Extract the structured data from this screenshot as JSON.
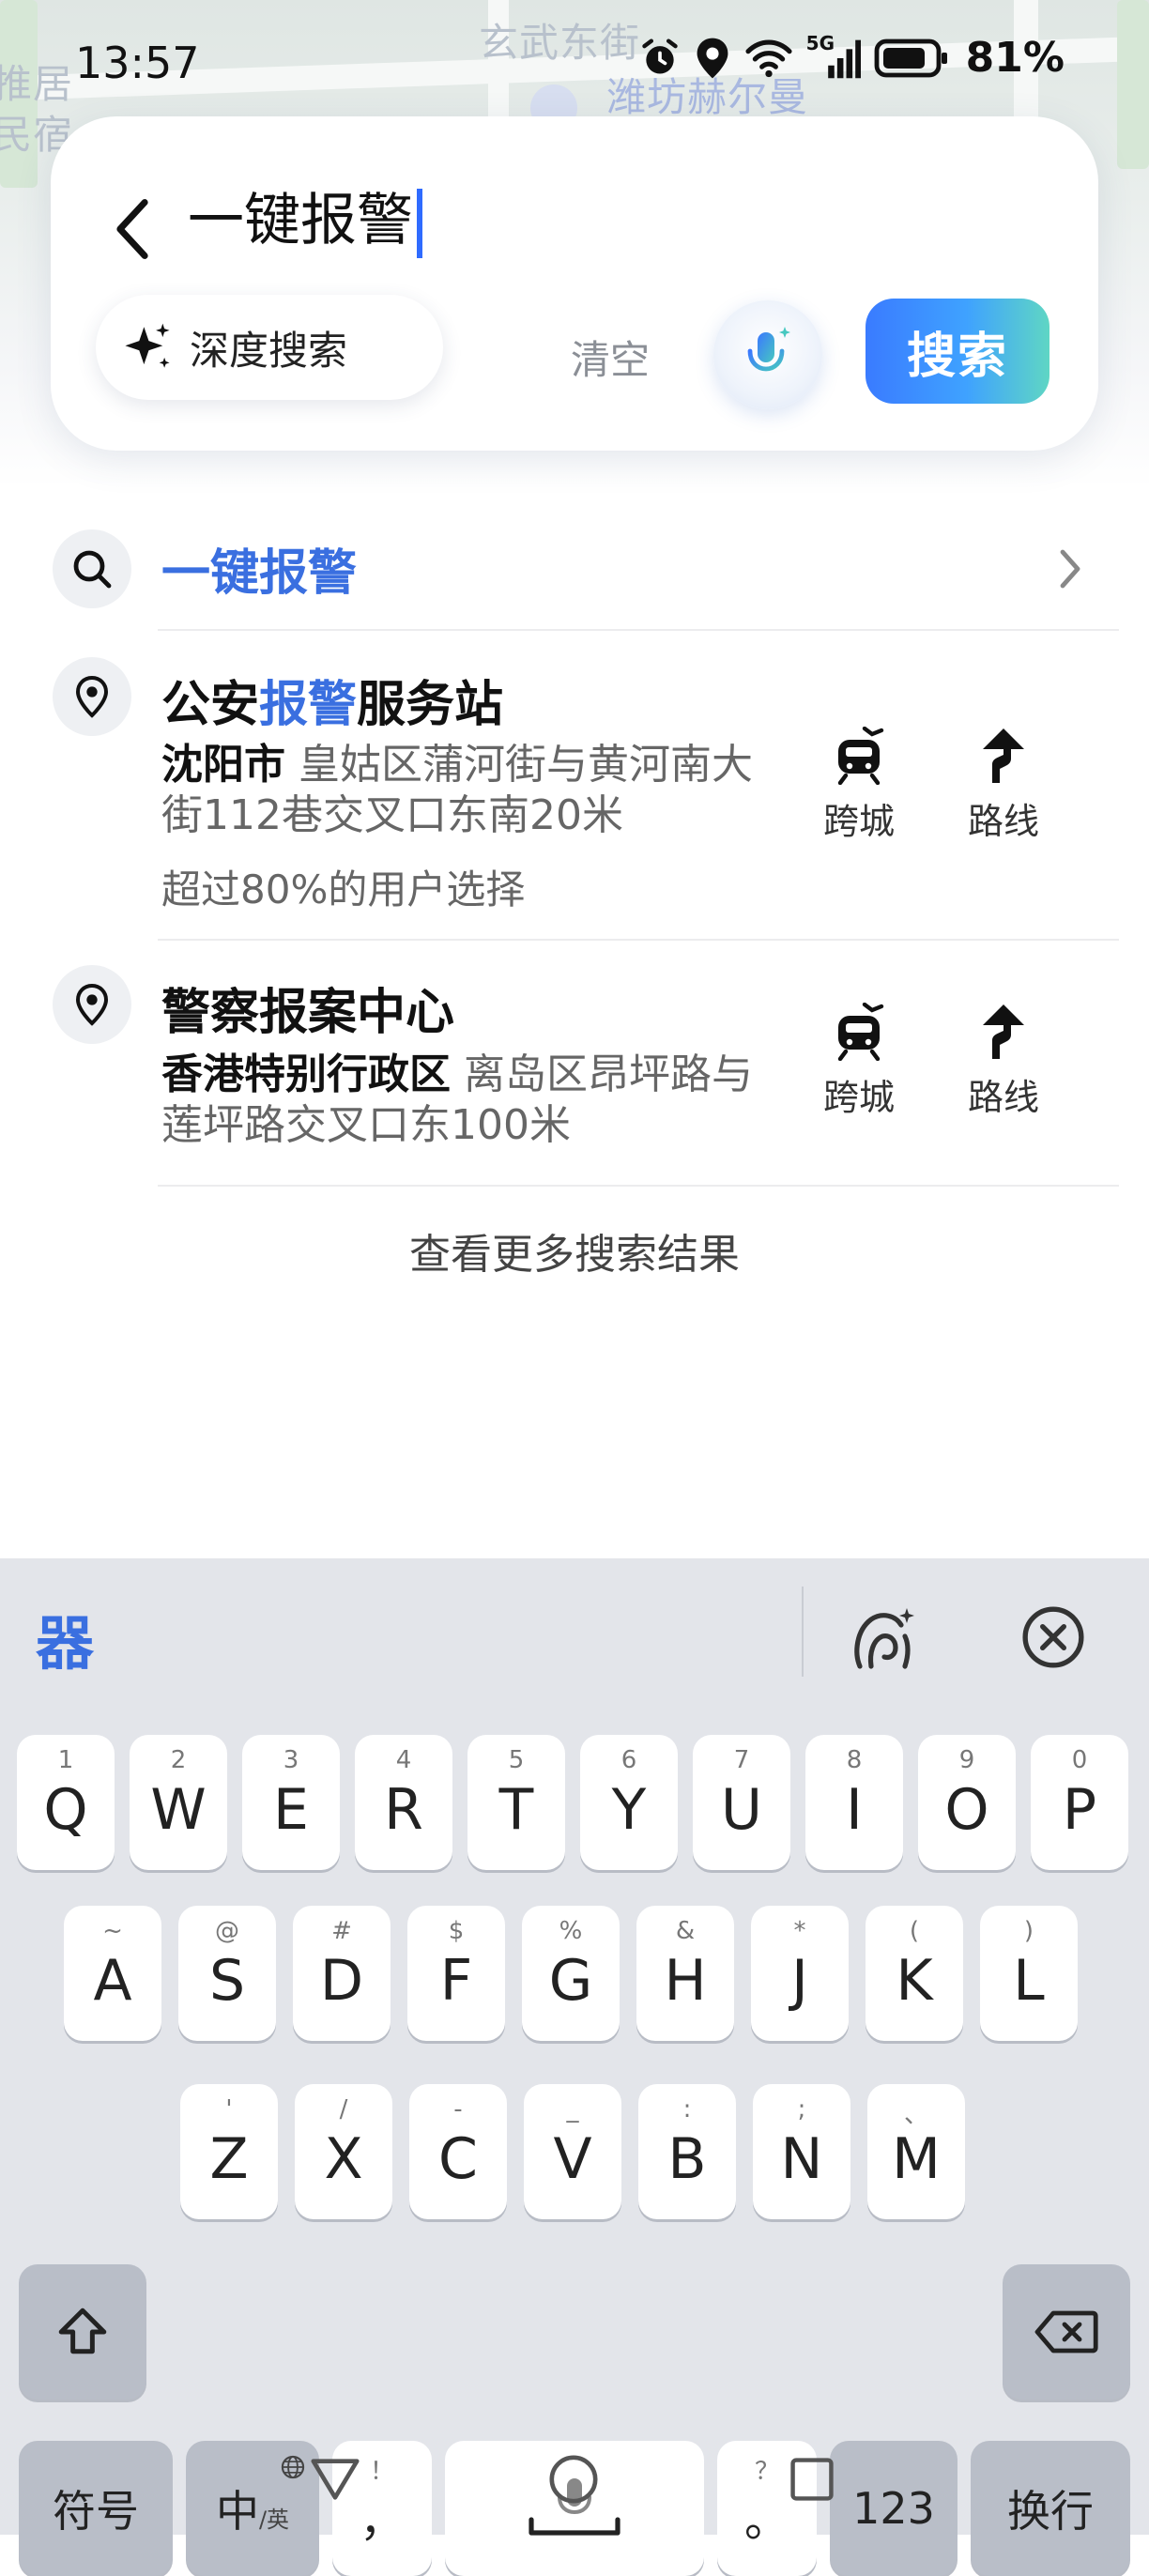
{
  "status_bar": {
    "time": "13:57",
    "battery": "81%",
    "network": "5G",
    "icons": [
      "alarm-icon",
      "location-icon",
      "wifi-icon",
      "signal-icon",
      "battery-icon"
    ]
  },
  "map": {
    "labels": [
      "玄武东街",
      "潍坊赫尔曼",
      "推居",
      "民宿"
    ]
  },
  "search": {
    "query": "一键报警",
    "deep_search_label": "深度搜索",
    "clear_label": "清空",
    "search_button": "搜索"
  },
  "suggestion": {
    "text": "一键报警"
  },
  "results": [
    {
      "title_pre": "公安",
      "title_hl": "报警",
      "title_post": "服务站",
      "city": "沈阳市",
      "address": "皇姑区蒲河街与黄河南大街112巷交叉口东南20米",
      "note": "超过80%的用户选择",
      "action1": "跨城",
      "action2": "路线"
    },
    {
      "title_pre": "警察报案中心",
      "title_hl": "",
      "title_post": "",
      "city": "香港特别行政区",
      "address": "离岛区昂坪路与莲坪路交叉口东100米",
      "note": "",
      "action1": "跨城",
      "action2": "路线"
    }
  ],
  "more_results": "查看更多搜索结果",
  "keyboard": {
    "logo": "器",
    "row1": [
      {
        "main": "Q",
        "sub": "1"
      },
      {
        "main": "W",
        "sub": "2"
      },
      {
        "main": "E",
        "sub": "3"
      },
      {
        "main": "R",
        "sub": "4"
      },
      {
        "main": "T",
        "sub": "5"
      },
      {
        "main": "Y",
        "sub": "6"
      },
      {
        "main": "U",
        "sub": "7"
      },
      {
        "main": "I",
        "sub": "8"
      },
      {
        "main": "O",
        "sub": "9"
      },
      {
        "main": "P",
        "sub": "0"
      }
    ],
    "row2": [
      {
        "main": "A",
        "sub": "~"
      },
      {
        "main": "S",
        "sub": "@"
      },
      {
        "main": "D",
        "sub": "#"
      },
      {
        "main": "F",
        "sub": "$"
      },
      {
        "main": "G",
        "sub": "%"
      },
      {
        "main": "H",
        "sub": "&"
      },
      {
        "main": "J",
        "sub": "*"
      },
      {
        "main": "K",
        "sub": "("
      },
      {
        "main": "L",
        "sub": ")"
      }
    ],
    "row3": [
      {
        "main": "Z",
        "sub": "'"
      },
      {
        "main": "X",
        "sub": "/"
      },
      {
        "main": "C",
        "sub": "-"
      },
      {
        "main": "V",
        "sub": "_"
      },
      {
        "main": "B",
        "sub": ":"
      },
      {
        "main": "N",
        "sub": ";"
      },
      {
        "main": "M",
        "sub": "、"
      }
    ],
    "symbols": "符号",
    "lang_main": "中",
    "lang_sub": "/英",
    "comma_main": "，",
    "comma_sub": "！",
    "period_main": "。",
    "period_sub": "？",
    "numbers": "123",
    "enter": "换行"
  }
}
